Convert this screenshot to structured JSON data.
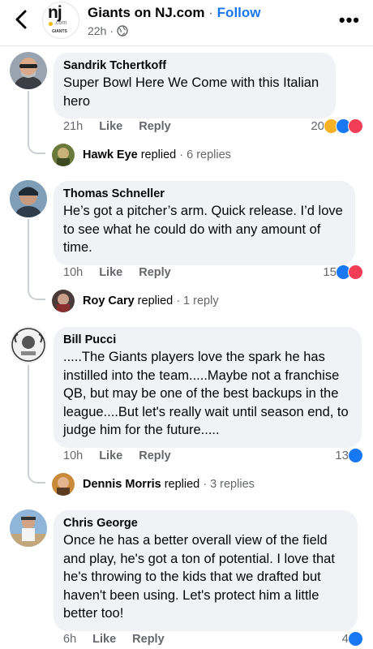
{
  "header": {
    "page_name": "Giants on NJ.com",
    "separator": "·",
    "follow_label": "Follow",
    "time": "22h",
    "time_sep": "·",
    "logo_text_main": "nj",
    "logo_text_sub": ".com",
    "logo_text_team": "GIANTS",
    "more_label": "•••"
  },
  "comments": [
    {
      "author": "Sandrik Tchertkoff",
      "text": "Super Bowl Here We Come with this Italian hero",
      "time": "21h",
      "like_label": "Like",
      "reply_label": "Reply",
      "reaction_count": "20",
      "reactions": [
        "haha",
        "like",
        "love"
      ],
      "replies": {
        "name": "Hawk Eye",
        "verb": "replied",
        "count": "· 6 replies"
      }
    },
    {
      "author": "Thomas Schneller",
      "text": "He’s got a pitcher’s arm. Quick release. I’d love to see what he could do with any amount of time.",
      "time": "10h",
      "like_label": "Like",
      "reply_label": "Reply",
      "reaction_count": "15",
      "reactions": [
        "like",
        "love"
      ],
      "replies": {
        "name": "Roy Cary",
        "verb": "replied",
        "count": "· 1 reply"
      }
    },
    {
      "author": "Bill Pucci",
      "text": ".....The Giants players love the spark he has instilled into the team.....Maybe not a franchise QB, but may be one of the best backups in the league....But let's really wait until season end, to judge him for the future.....",
      "time": "10h",
      "like_label": "Like",
      "reply_label": "Reply",
      "reaction_count": "13",
      "reactions": [
        "like"
      ],
      "replies": {
        "name": "Dennis Morris",
        "verb": "replied",
        "count": "· 3 replies"
      }
    },
    {
      "author": "Chris George",
      "text": "Once he has a better overall view of the field and play, he's got a ton of potential. I love that he's throwing to the kids that we drafted but haven't been using. Let's protect him a little better too!",
      "time": "6h",
      "like_label": "Like",
      "reply_label": "Reply",
      "reaction_count": "4",
      "reactions": [
        "like"
      ]
    }
  ],
  "colors": {
    "link_blue": "#1877f2",
    "bubble_bg": "#f0f2f5",
    "muted_text": "#65676b",
    "love_red": "#f33e58",
    "haha_yellow": "#f7b125"
  }
}
